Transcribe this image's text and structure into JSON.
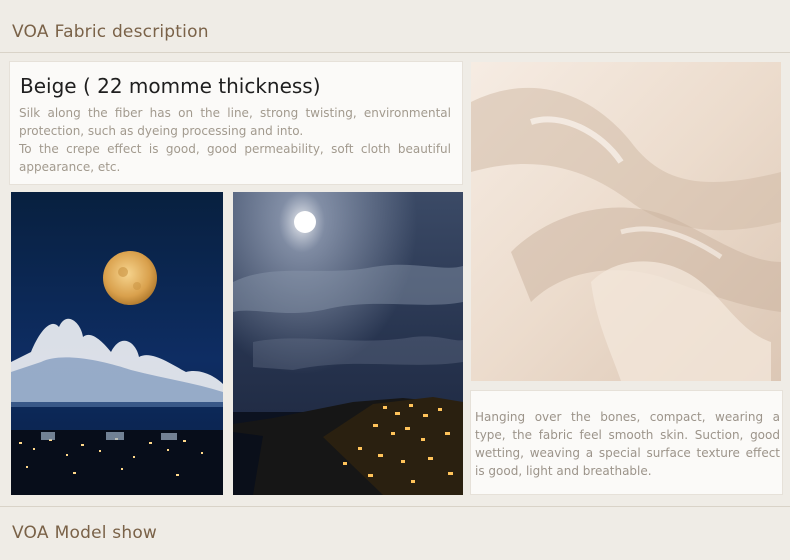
{
  "sections": {
    "fabric": {
      "brand": "VOA",
      "label": "Fabric description"
    },
    "model": {
      "brand": "VOA",
      "label": "Model show"
    }
  },
  "description": {
    "title": "Beige ( 22 momme thickness)",
    "paragraphs": [
      "Silk along the fiber has on the line, strong twisting, environmental protection, such as dyeing processing and into.",
      "To the crepe effect is good, good permeability, soft cloth beautiful appearance, etc."
    ]
  },
  "fabric_note": "Hanging over the bones, compact, wearing a type, the fabric feel smooth skin. Suction, good wetting, weaving a special surface texture effect is good, light and breathable.",
  "images": [
    {
      "name": "full-moon-clouds-photo"
    },
    {
      "name": "moonlit-coastal-village-photo"
    },
    {
      "name": "beige-silk-fabric-photo"
    }
  ]
}
